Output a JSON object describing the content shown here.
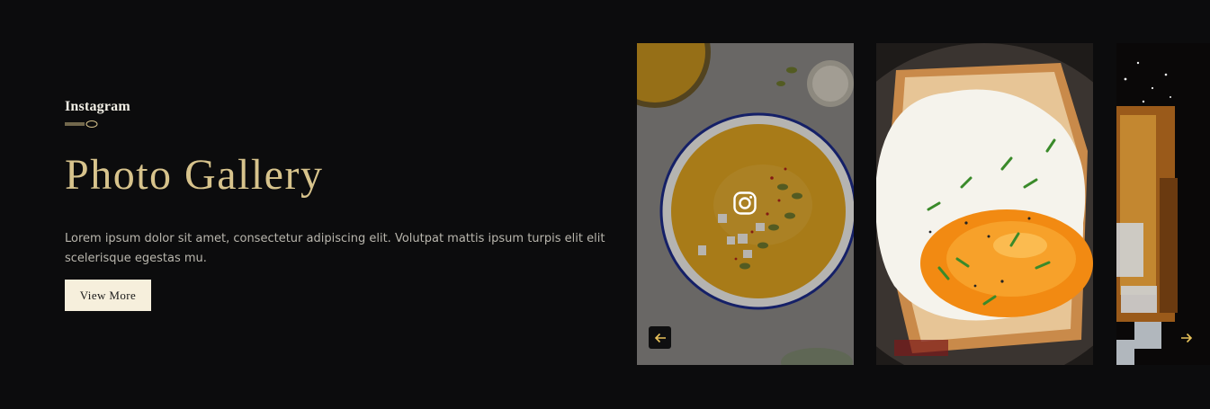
{
  "section": {
    "eyebrow": "Instagram",
    "title": "Photo Gallery",
    "description": "Lorem ipsum dolor sit amet, consectetur adipiscing elit. Volutpat mattis ipsum turpis elit elit scelerisque egestas mu.",
    "button_label": "View More"
  },
  "gallery": {
    "items": [
      {
        "subject": "pumpkin soup bowl",
        "hover_icon": "instagram-icon"
      },
      {
        "subject": "fried egg on toast"
      },
      {
        "subject": "iced whiskey drink"
      }
    ],
    "prev_icon": "arrow-left-icon",
    "next_icon": "arrow-right-icon"
  },
  "colors": {
    "background": "#0c0c0d",
    "accent_gold": "#d7c38c",
    "button_bg": "#f6efdc",
    "nav_arrow": "#e8c25a"
  }
}
